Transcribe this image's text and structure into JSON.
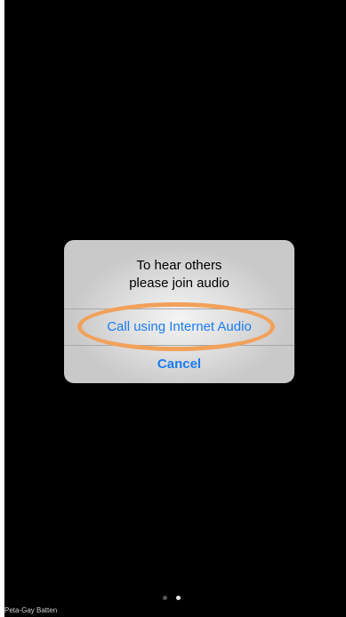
{
  "dialog": {
    "title_line1": "To hear others",
    "title_line2": "please join audio",
    "internet_audio_label": "Call using Internet Audio",
    "cancel_label": "Cancel"
  },
  "participant": {
    "name": "Peta-Gay Batten"
  },
  "pagination": {
    "total_pages": 2,
    "active_page": 2
  },
  "colors": {
    "background": "#000000",
    "dialog_background": "#e2e2e2",
    "button_text": "#1a7cf5",
    "highlight_ring": "#f2a15a"
  }
}
